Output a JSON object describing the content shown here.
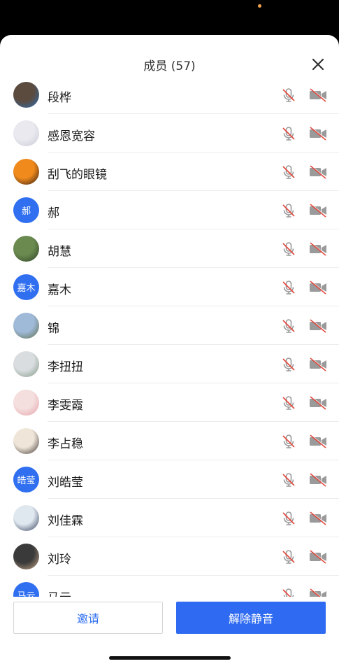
{
  "header": {
    "title": "成员 (57)"
  },
  "members": [
    {
      "name": "段桦",
      "avatar": {
        "type": "photo",
        "c1": "#5b4b3f",
        "c2": "#2a6fb5"
      }
    },
    {
      "name": "感恩宽容",
      "avatar": {
        "type": "photo",
        "c1": "#e9e9ef",
        "c2": "#c9c9d6"
      }
    },
    {
      "name": "刮飞的眼镜",
      "avatar": {
        "type": "photo",
        "c1": "#f08a1c",
        "c2": "#2b1a12"
      }
    },
    {
      "name": "郝",
      "avatar": {
        "type": "text",
        "text": "郝"
      }
    },
    {
      "name": "胡慧",
      "avatar": {
        "type": "photo",
        "c1": "#6a8a4f",
        "c2": "#2f3f25"
      }
    },
    {
      "name": "嘉木",
      "avatar": {
        "type": "text",
        "text": "嘉木"
      }
    },
    {
      "name": "锦",
      "avatar": {
        "type": "photo",
        "c1": "#9fb9d9",
        "c2": "#5e6e4a"
      }
    },
    {
      "name": "李扭扭",
      "avatar": {
        "type": "photo",
        "c1": "#d9dde0",
        "c2": "#7e9580"
      }
    },
    {
      "name": "李雯霞",
      "avatar": {
        "type": "photo",
        "c1": "#f4dede",
        "c2": "#e6a1a8"
      }
    },
    {
      "name": "李占稳",
      "avatar": {
        "type": "photo",
        "c1": "#efe6d9",
        "c2": "#3a2e2a"
      }
    },
    {
      "name": "刘皓莹",
      "avatar": {
        "type": "text",
        "text": "皓莹"
      }
    },
    {
      "name": "刘佳霖",
      "avatar": {
        "type": "photo",
        "c1": "#dfe7ef",
        "c2": "#2b3a55"
      }
    },
    {
      "name": "刘玲",
      "avatar": {
        "type": "photo",
        "c1": "#3a3a3a",
        "c2": "#c9a98a"
      }
    },
    {
      "name": "马云",
      "avatar": {
        "type": "text",
        "text": "马云"
      }
    }
  ],
  "buttons": {
    "invite": "邀请",
    "unmute_all": "解除静音"
  },
  "colors": {
    "accent": "#2e6bf2",
    "muted_icon": "#9a9a9a",
    "slash": "#e2463b"
  }
}
